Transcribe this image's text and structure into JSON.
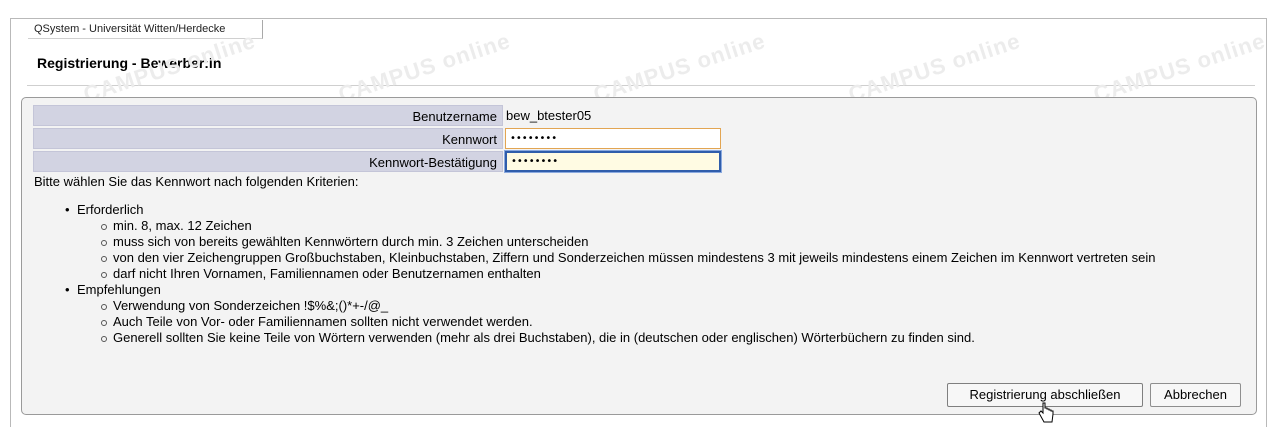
{
  "window": {
    "tab_label": "QSystem - Universität Witten/Herdecke"
  },
  "header": {
    "title": "Registrierung - Bewerber:in"
  },
  "watermark": {
    "text": "CAMPUS online"
  },
  "form": {
    "username_label": "Benutzername",
    "username_value": "bew_btester05",
    "password_label": "Kennwort",
    "password_value": "••••••••",
    "confirm_label": "Kennwort-Bestätigung",
    "confirm_value": "••••••••"
  },
  "criteria": {
    "intro": "Bitte wählen Sie das Kennwort nach folgenden Kriterien:",
    "groups": [
      {
        "title": "Erforderlich",
        "items": [
          "min. 8, max. 12 Zeichen",
          "muss sich von bereits gewählten Kennwörtern durch min. 3 Zeichen unterscheiden",
          "von den vier Zeichengruppen Großbuchstaben, Kleinbuchstaben, Ziffern und Sonderzeichen müssen mindestens 3 mit jeweils mindestens einem Zeichen im Kennwort vertreten sein",
          "darf nicht Ihren Vornamen, Familiennamen oder Benutzernamen enthalten"
        ]
      },
      {
        "title": "Empfehlungen",
        "items": [
          "Verwendung von Sonderzeichen !$%&;()*+-/@_",
          "Auch Teile von Vor- oder Familiennamen sollten nicht verwendet werden.",
          "Generell sollten Sie keine Teile von Wörtern verwenden (mehr als drei Buchstaben), die in (deutschen oder englischen) Wörterbüchern zu finden sind."
        ]
      }
    ]
  },
  "buttons": {
    "submit": "Registrierung abschließen",
    "cancel": "Abbrechen"
  },
  "colors": {
    "label_bg": "#d2d3e2",
    "focus_border": "#2f5dab",
    "input_border": "#e2a552"
  },
  "icons": {
    "cursor": "hand-pointer-icon"
  }
}
